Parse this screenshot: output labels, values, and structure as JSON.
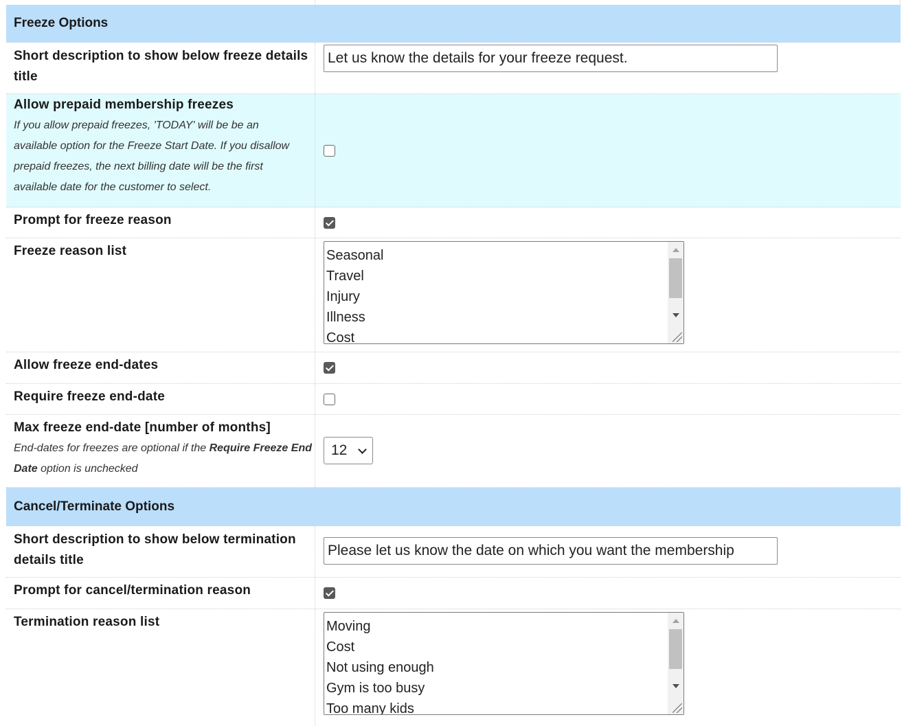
{
  "freeze_section": {
    "title": "Freeze Options",
    "short_desc": {
      "label": "Short description to show below freeze details title",
      "value": "Let us know the details for your freeze request."
    },
    "allow_prepaid": {
      "label": "Allow prepaid membership freezes",
      "help": "If you allow prepaid freezes, 'TODAY' will be be an available option for the Freeze Start Date. If you disallow prepaid freezes, the next billing date will be the first available date for the customer to select.",
      "checked": false
    },
    "prompt_reason": {
      "label": "Prompt for freeze reason",
      "checked": true
    },
    "reason_list": {
      "label": "Freeze reason list",
      "items": [
        "Seasonal",
        "Travel",
        "Injury",
        "Illness",
        "Cost"
      ]
    },
    "allow_end_dates": {
      "label": "Allow freeze end-dates",
      "checked": true
    },
    "require_end_date": {
      "label": "Require freeze end-date",
      "checked": false
    },
    "max_end_date": {
      "label": "Max freeze end-date [number of months]",
      "help_pre": "End-dates for freezes are optional if the ",
      "help_bold": "Require Freeze End Date",
      "help_post": " option is unchecked",
      "value": "12"
    }
  },
  "cancel_section": {
    "title": "Cancel/Terminate Options",
    "short_desc": {
      "label": "Short description to show below termination details title",
      "value": "Please let us know the date on which you want the membership"
    },
    "prompt_reason": {
      "label": "Prompt for cancel/termination reason",
      "checked": true
    },
    "reason_list": {
      "label": "Termination reason list",
      "items": [
        "Moving",
        "Cost",
        "Not using enough",
        "Gym is too busy",
        "Too many kids"
      ]
    }
  },
  "icons": {
    "scroll_up": "triangle-up",
    "scroll_down": "triangle-down",
    "dropdown": "chevron-down",
    "resize": "resize-grip"
  }
}
